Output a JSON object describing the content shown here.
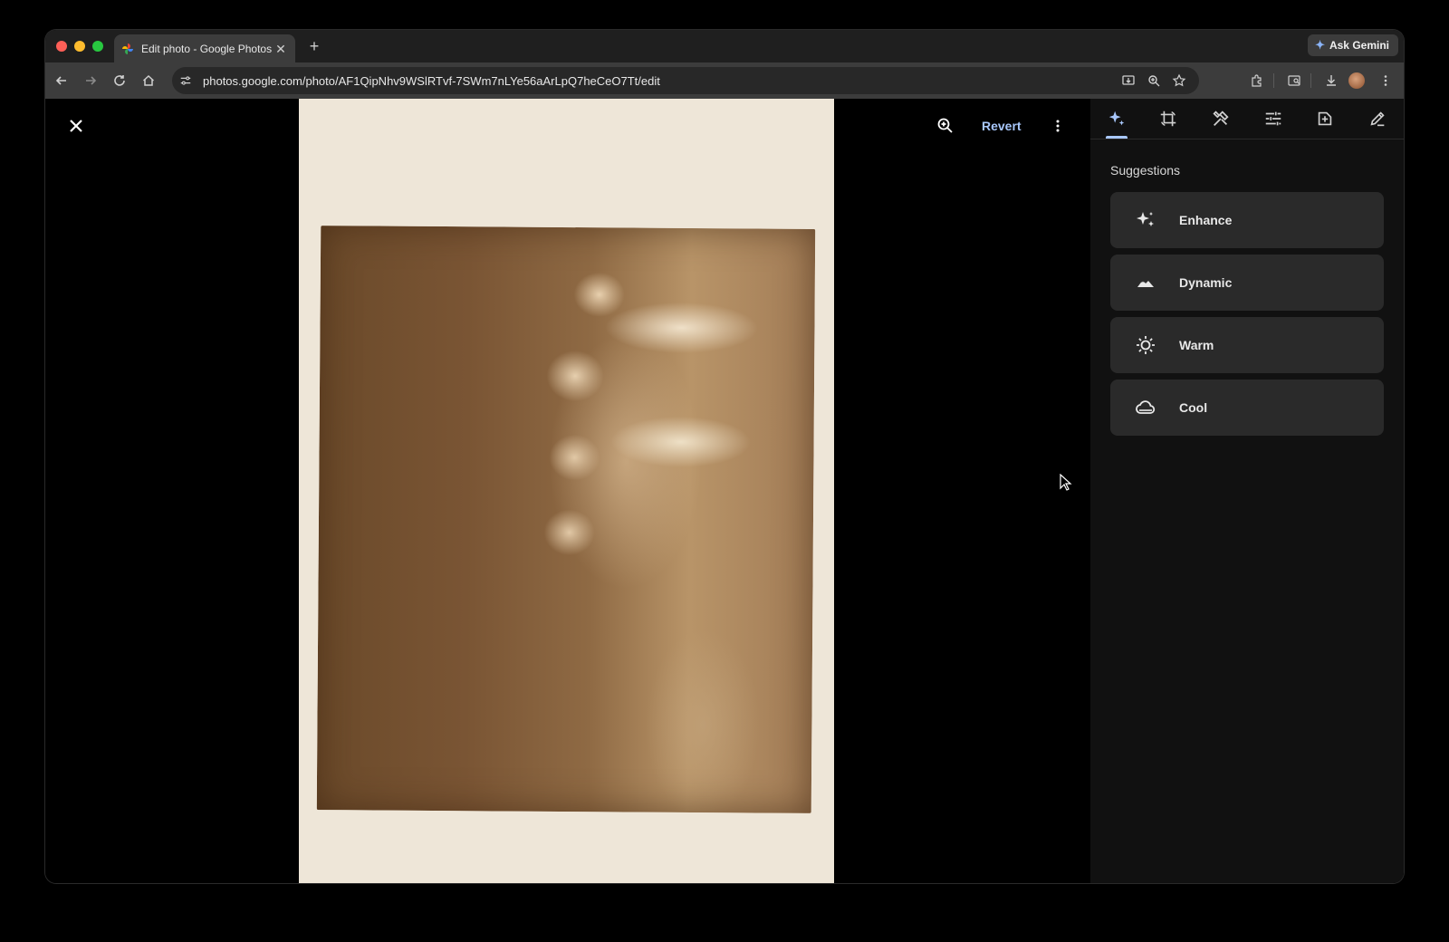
{
  "browser": {
    "tab": {
      "title": "Edit photo - Google Photos",
      "favicon": "google-photos-favicon"
    },
    "new_tab_label": "+",
    "gemini_label": "Ask Gemini",
    "url": "photos.google.com/photo/AF1QipNhv9WSlRTvf-7SWm7nLYe56aArLpQ7heCeO7Tt/edit"
  },
  "editor": {
    "actions": {
      "revert_label": "Revert"
    },
    "panel": {
      "tabs": [
        "suggestions",
        "crop",
        "tools",
        "adjust",
        "filters",
        "markup"
      ],
      "active_tab": "suggestions",
      "heading": "Suggestions",
      "suggestions": [
        {
          "label": "Enhance",
          "icon": "sparkle-icon"
        },
        {
          "label": "Dynamic",
          "icon": "mountain-icon"
        },
        {
          "label": "Warm",
          "icon": "sun-icon"
        },
        {
          "label": "Cool",
          "icon": "cloud-icon"
        }
      ]
    }
  },
  "colors": {
    "accent": "#a8c7fa",
    "panel_bg": "#111111",
    "card_bg": "#2a2a2a",
    "toolbar_bg": "#3c3c3c"
  }
}
